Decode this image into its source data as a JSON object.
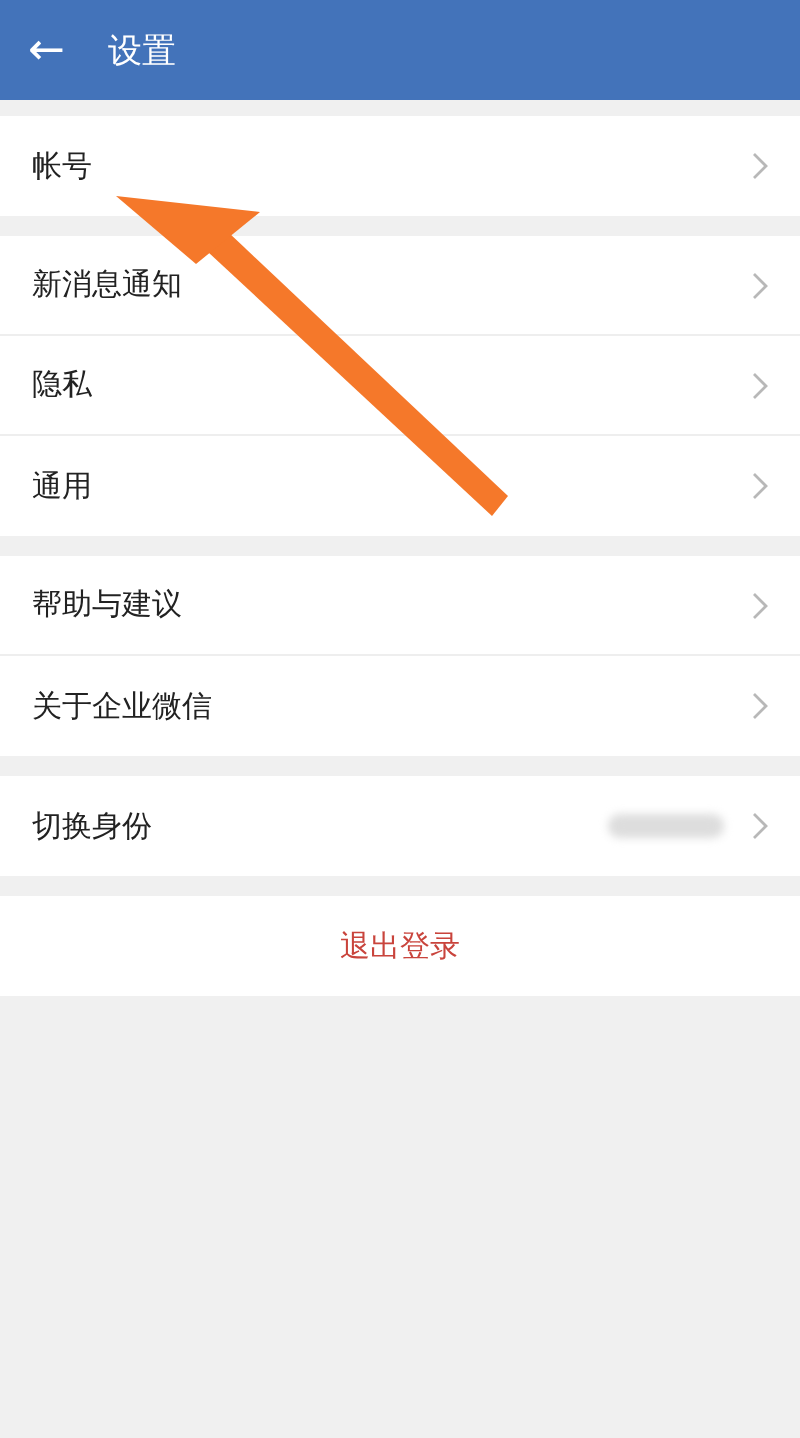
{
  "header": {
    "back_icon": "←",
    "title": "设置"
  },
  "groups": [
    {
      "items": [
        {
          "label": "帐号",
          "blurred_value": false
        }
      ]
    },
    {
      "items": [
        {
          "label": "新消息通知",
          "blurred_value": false
        },
        {
          "label": "隐私",
          "blurred_value": false
        },
        {
          "label": "通用",
          "blurred_value": false
        }
      ]
    },
    {
      "items": [
        {
          "label": "帮助与建议",
          "blurred_value": false
        },
        {
          "label": "关于企业微信",
          "blurred_value": false
        }
      ]
    },
    {
      "items": [
        {
          "label": "切换身份",
          "blurred_value": true
        }
      ]
    }
  ],
  "logout": "退出登录",
  "annotation": {
    "kind": "arrow"
  }
}
